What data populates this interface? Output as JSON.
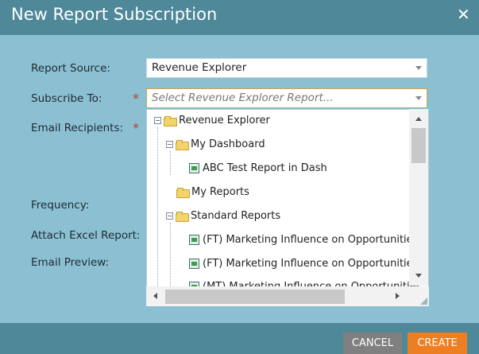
{
  "dialog": {
    "title": "New Report Subscription",
    "close_icon": "close-icon"
  },
  "form": {
    "report_source_label": "Report Source:",
    "report_source_value": "Revenue Explorer",
    "subscribe_to_label": "Subscribe To:",
    "subscribe_to_placeholder": "Select Revenue Explorer Report...",
    "email_recipients_label": "Email Recipients:",
    "frequency_label": "Frequency:",
    "attach_excel_label": "Attach Excel Report:",
    "email_preview_label": "Email Preview:",
    "required_mark": "*"
  },
  "tree": {
    "root": "Revenue Explorer",
    "my_dashboard": "My Dashboard",
    "abc_report": "ABC Test Report in Dash",
    "my_reports": "My Reports",
    "standard_reports": "Standard Reports",
    "ft_report_1": "(FT) Marketing Influence on Opportunities (",
    "ft_report_2": "(FT) Marketing Influence on Opportunities (",
    "mt_report": "(MT) Marketing Influence on Opportunities"
  },
  "footer": {
    "cancel_label": "CANCEL",
    "create_label": "CREATE"
  },
  "colors": {
    "header": "#4e8899",
    "background": "#8bc0d3",
    "create": "#ee7e22",
    "cancel": "#808080",
    "required": "#c0392b"
  }
}
